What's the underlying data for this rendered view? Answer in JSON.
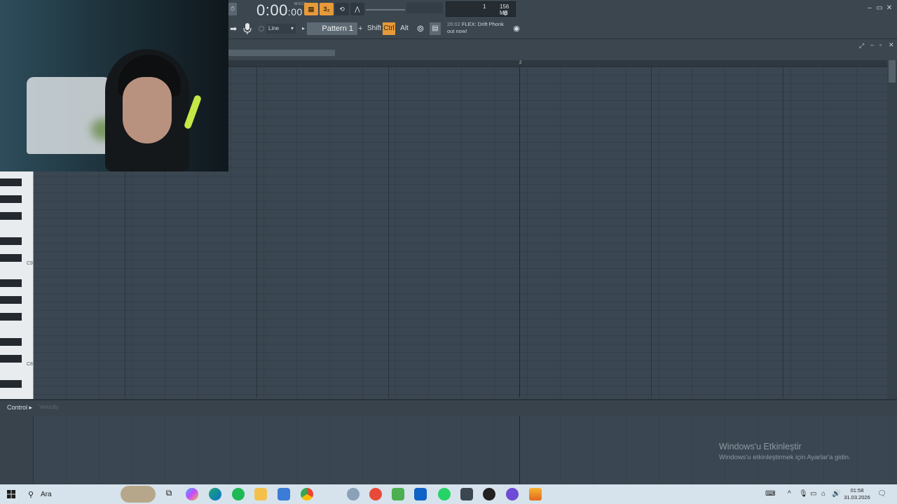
{
  "toolbar": {
    "time_main": "0:00",
    "time_small": "00",
    "time_caption": "M:S:CS",
    "meter_value_1": "1",
    "meter_value_2": "0",
    "memory": "156 MB",
    "pattern_label": "Pattern 1",
    "record_source": "Line",
    "modifiers": [
      "Shift",
      "Ctrl",
      "Alt"
    ],
    "news_time": "26:02",
    "news_text": "FLEX: Drift Phonk",
    "news_text2": "out now!"
  },
  "piano_roll": {
    "ruler_bar": "2",
    "octave_labels": [
      "C9",
      "C8"
    ]
  },
  "control_lane": {
    "label": "Control",
    "sub_label": "Velocity"
  },
  "watermark": {
    "title": "Windows'u Etkinleştir",
    "subtitle": "Windows'u etkinleştirmek için Ayarlar'a gidin."
  },
  "taskbar": {
    "search_placeholder": "Ara",
    "clock_time": "01:58",
    "clock_date": "31.03.2026"
  },
  "colors": {
    "accent": "#e69a3a",
    "grid_bg": "#3a4651",
    "toolbar_bg": "#3b464f",
    "taskbar_bg": "#d6e3ec"
  }
}
